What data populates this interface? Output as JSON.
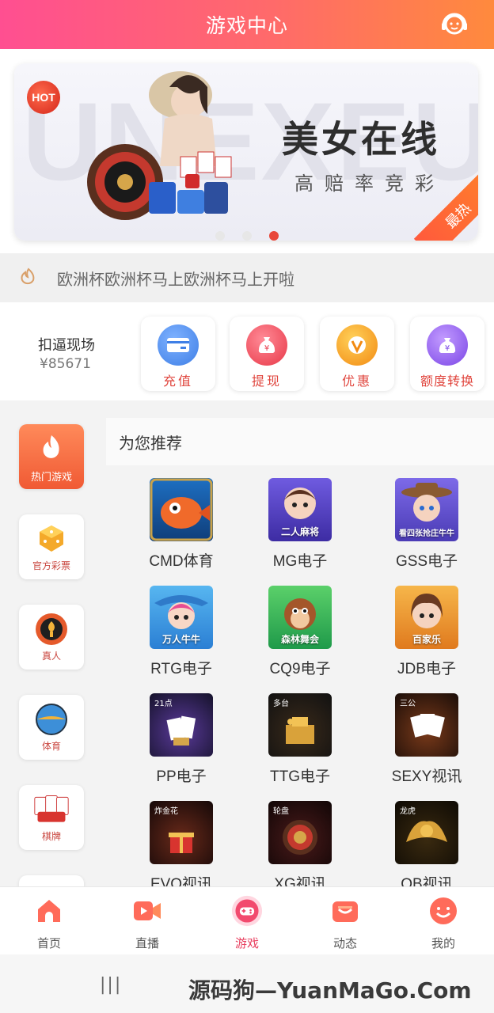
{
  "header": {
    "title": "游戏中心",
    "support_icon": "customer-service-icon"
  },
  "banner": {
    "hot_badge": "HOT",
    "background_text": "UNEXEURO",
    "headline": "美女在线",
    "subline": "高赔率竞彩",
    "corner_tag": "最热",
    "dots_count": 3,
    "active_dot": 3
  },
  "notice": {
    "icon": "flame-icon",
    "text": "欧洲杯欧洲杯马上欧洲杯马上开啦"
  },
  "wallet": {
    "name": "扣逼现场",
    "balance": "¥85671",
    "actions": [
      {
        "label": "充值",
        "icon": "card-icon",
        "color": "#4a8ef0"
      },
      {
        "label": "提现",
        "icon": "money-bag-icon",
        "color": "#f0485a"
      },
      {
        "label": "优惠",
        "icon": "vip-icon",
        "color": "#f7a21b"
      },
      {
        "label": "额度转换",
        "icon": "coin-bag-icon",
        "color": "#8e5cf0"
      }
    ]
  },
  "categories": [
    {
      "label": "热门游戏",
      "icon": "fire-icon",
      "active": true
    },
    {
      "label": "官方彩票",
      "icon": "dice-icon",
      "active": false
    },
    {
      "label": "真人",
      "icon": "poker-chip-icon",
      "active": false
    },
    {
      "label": "体育",
      "icon": "ball-icon",
      "active": false
    },
    {
      "label": "棋牌",
      "icon": "cards-icon",
      "active": false
    }
  ],
  "recommend": {
    "title": "为您推荐",
    "games": [
      {
        "name": "CMD体育",
        "caption": "",
        "tag": ""
      },
      {
        "name": "MG电子",
        "caption": "二人麻将",
        "tag": ""
      },
      {
        "name": "GSS电子",
        "caption": "看四张抢庄牛牛",
        "tag": ""
      },
      {
        "name": "RTG电子",
        "caption": "万人牛牛",
        "tag": ""
      },
      {
        "name": "CQ9电子",
        "caption": "森林舞会",
        "tag": ""
      },
      {
        "name": "JDB电子",
        "caption": "百家乐",
        "tag": ""
      },
      {
        "name": "PP电子",
        "caption": "",
        "tag": "21点"
      },
      {
        "name": "TTG电子",
        "caption": "",
        "tag": "多台"
      },
      {
        "name": "SEXY视讯",
        "caption": "",
        "tag": "三公"
      },
      {
        "name": "EVO视讯",
        "caption": "",
        "tag": "炸金花"
      },
      {
        "name": "XG视讯",
        "caption": "",
        "tag": "轮盘"
      },
      {
        "name": "OB视讯",
        "caption": "",
        "tag": "龙虎"
      }
    ]
  },
  "tabbar": {
    "items": [
      {
        "label": "首页",
        "icon": "home-icon"
      },
      {
        "label": "直播",
        "icon": "video-icon"
      },
      {
        "label": "游戏",
        "icon": "gamepad-icon",
        "active": true
      },
      {
        "label": "动态",
        "icon": "feed-icon"
      },
      {
        "label": "我的",
        "icon": "smile-icon"
      }
    ]
  },
  "system_bar": {
    "watermark": "源码狗—YuanMaGo.Com",
    "menu_glyph": "|||"
  }
}
